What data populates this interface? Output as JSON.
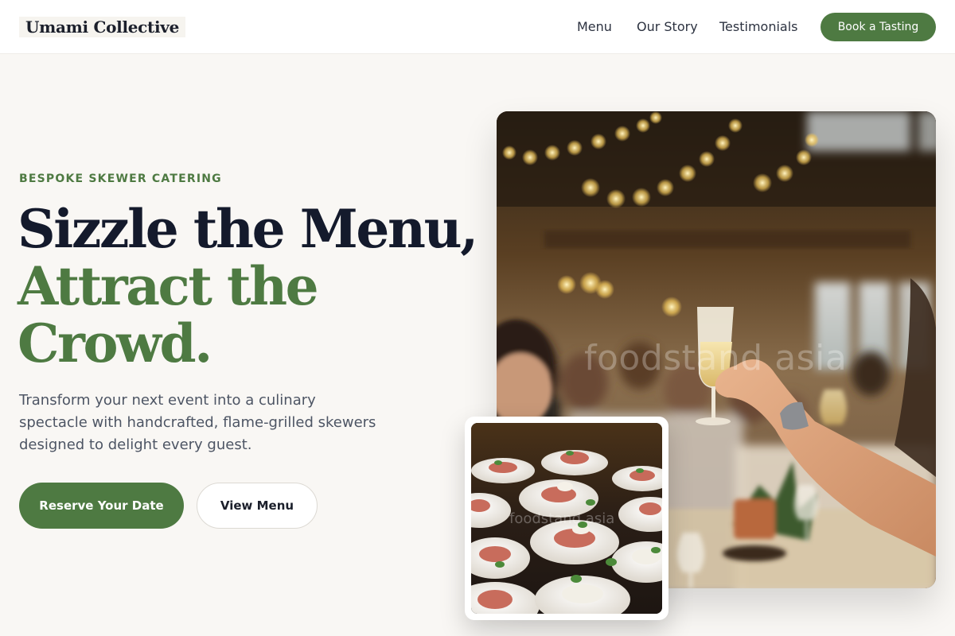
{
  "brand": {
    "name": "Umami Collective"
  },
  "nav": {
    "items": [
      {
        "label": "Menu"
      },
      {
        "label": "Our Story"
      },
      {
        "label": "Testimonials"
      }
    ],
    "cta_label": "Book a Tasting"
  },
  "hero": {
    "eyebrow": "BESPOKE SKEWER CATERING",
    "headline_line1": "Sizzle the Menu,",
    "headline_line2": "Attract the",
    "headline_line3": "Crowd.",
    "subtext": "Transform your next event into a culinary spectacle with handcrafted, flame-grilled skewers designed to delight every guest.",
    "primary_cta": "Reserve Your Date",
    "secondary_cta": "View Menu",
    "main_image": {
      "watermark": "foodstand asia"
    },
    "inset_image": {
      "watermark": "foodstand asia"
    }
  },
  "colors": {
    "accent_green": "#4e7a42",
    "headline_dark": "#141a2c",
    "page_background": "#f9f7f4"
  }
}
